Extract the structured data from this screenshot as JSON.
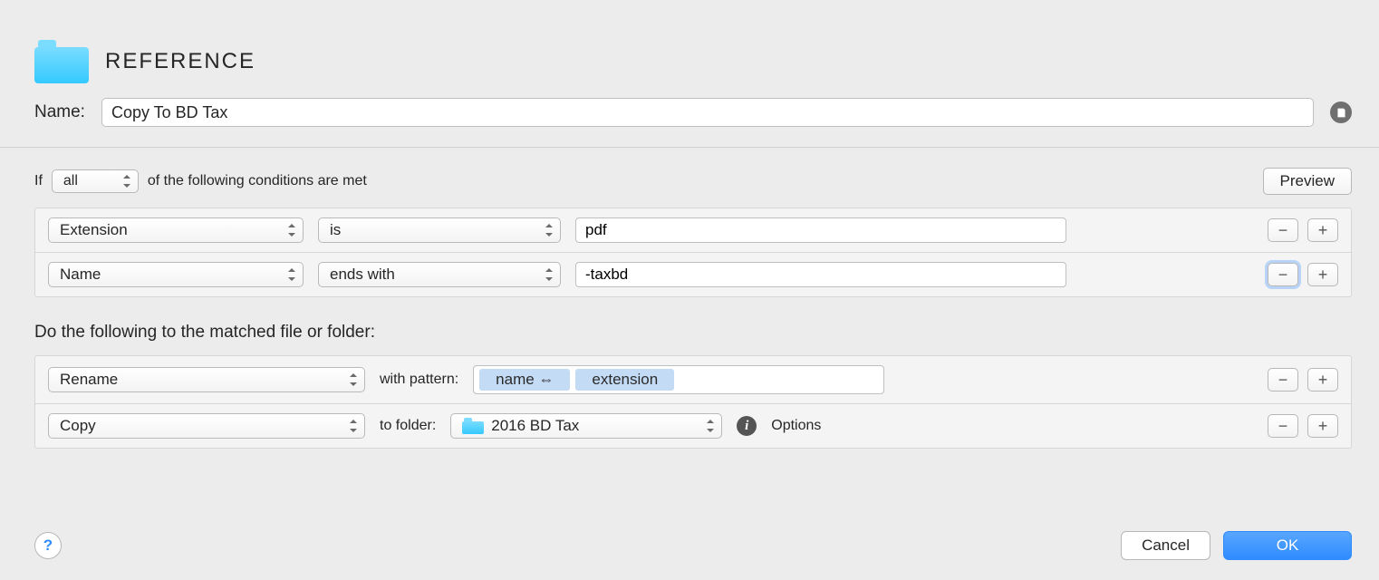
{
  "header": {
    "title": "REFERENCE",
    "name_label": "Name:",
    "name_value": "Copy To BD Tax"
  },
  "conditions": {
    "if_label": "If",
    "scope": "all",
    "trail_label": "of the following conditions are met",
    "preview_label": "Preview",
    "rows": [
      {
        "attr": "Extension",
        "op": "is",
        "value": "pdf"
      },
      {
        "attr": "Name",
        "op": "ends with",
        "value": "-taxbd"
      }
    ]
  },
  "actions": {
    "heading": "Do the following to the matched file or folder:",
    "rows": [
      {
        "type": "Rename",
        "aux_label": "with pattern:",
        "tokens": [
          "name ⇔",
          "extension"
        ]
      },
      {
        "type": "Copy",
        "aux_label": "to folder:",
        "folder": "2016 BD Tax",
        "options_label": "Options"
      }
    ]
  },
  "footer": {
    "cancel": "Cancel",
    "ok": "OK"
  }
}
